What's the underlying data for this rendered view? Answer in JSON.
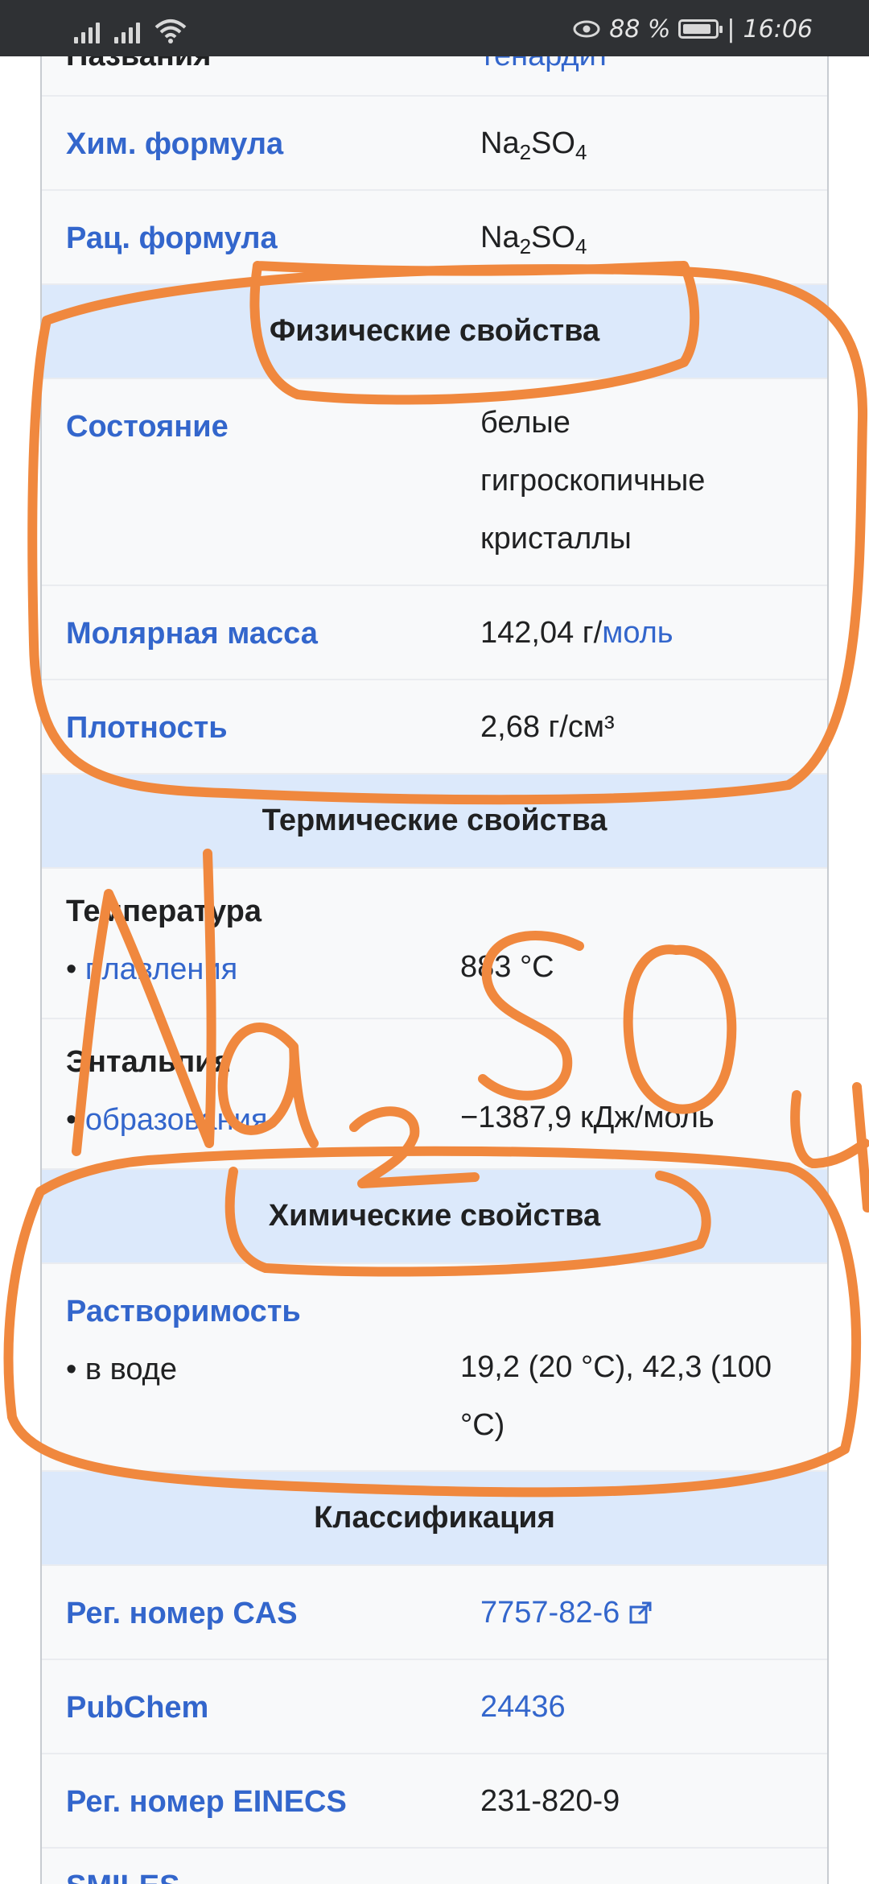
{
  "status_bar": {
    "battery": "88 %",
    "time": "16:06",
    "battery_level": 0.88
  },
  "infobox": {
    "top_cutoff_label": "Названия",
    "top_cutoff_value": "тенардит",
    "chem_formula": {
      "label": "Хим. формула",
      "value_prefix": "Na",
      "sub1": "2",
      "value_mid": "SO",
      "sub2": "4"
    },
    "rational_formula": {
      "label": "Рац. формула",
      "value_prefix": "Na",
      "sub1": "2",
      "value_mid": "SO",
      "sub2": "4"
    },
    "sections": {
      "physical": "Физические свойства",
      "thermal": "Термические свойства",
      "chemical": "Химические свойства",
      "classification": "Классификация"
    },
    "state": {
      "label": "Состояние",
      "value_lines": [
        "белые",
        "гигроскопичные",
        "кристаллы"
      ]
    },
    "molar_mass": {
      "label": "Молярная масса",
      "value": "142,04 г/",
      "unit_link": "моль"
    },
    "density": {
      "label": "Плотность",
      "value": "2,68 г/см³"
    },
    "temperature": {
      "label": "Температура",
      "sub_label": "плавления",
      "value": "883 °C"
    },
    "enthalpy": {
      "label": "Энтальпия",
      "sub_label": "образования",
      "value": "−1387,9 кДж/моль"
    },
    "solubility": {
      "label": "Растворимость",
      "sub_label": "в воде",
      "value_line1": "19,2 (20 °C), 42,3 (100",
      "value_line2": "°C)"
    },
    "cas": {
      "label": "Рег. номер CAS",
      "value": "7757-82-6"
    },
    "pubchem": {
      "label": "PubChem",
      "value": "24436"
    },
    "einecs": {
      "label": "Рег. номер EINECS",
      "value": "231-820-9"
    },
    "smiles": {
      "label": "SMILES"
    }
  },
  "annotation": {
    "handwritten_text": "Na2SO4",
    "color": "#f0883e"
  }
}
